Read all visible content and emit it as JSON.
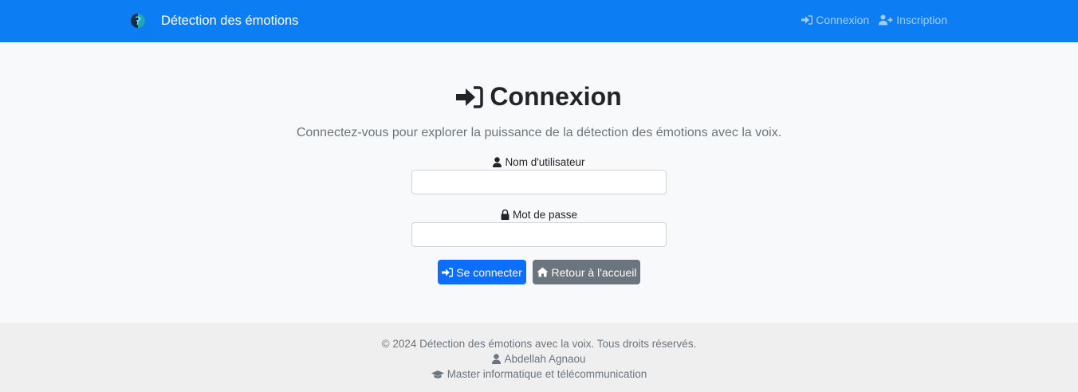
{
  "navbar": {
    "brand": "Détection des émotions",
    "links": [
      {
        "label": "Connexion",
        "icon": "sign-in-icon"
      },
      {
        "label": "Inscription",
        "icon": "user-plus-icon"
      }
    ]
  },
  "login": {
    "title": "Connexion",
    "subtitle": "Connectez-vous pour explorer la puissance de la détection des émotions avec la voix.",
    "username_label": "Nom d'utilisateur",
    "username_value": "",
    "password_label": "Mot de passe",
    "password_value": "",
    "submit_label": "Se connecter",
    "back_label": "Retour à l'accueil"
  },
  "footer": {
    "copyright": "© 2024 Détection des émotions avec la voix. Tous droits réservés.",
    "author": "Abdellah Agnaou",
    "program": "Master informatique et télécommunication"
  },
  "colors": {
    "navbar": "#0d7df4",
    "primary": "#0d6efd",
    "secondary": "#6c757d",
    "page_background": "#f8f9fa",
    "footer_background": "#efefef"
  }
}
